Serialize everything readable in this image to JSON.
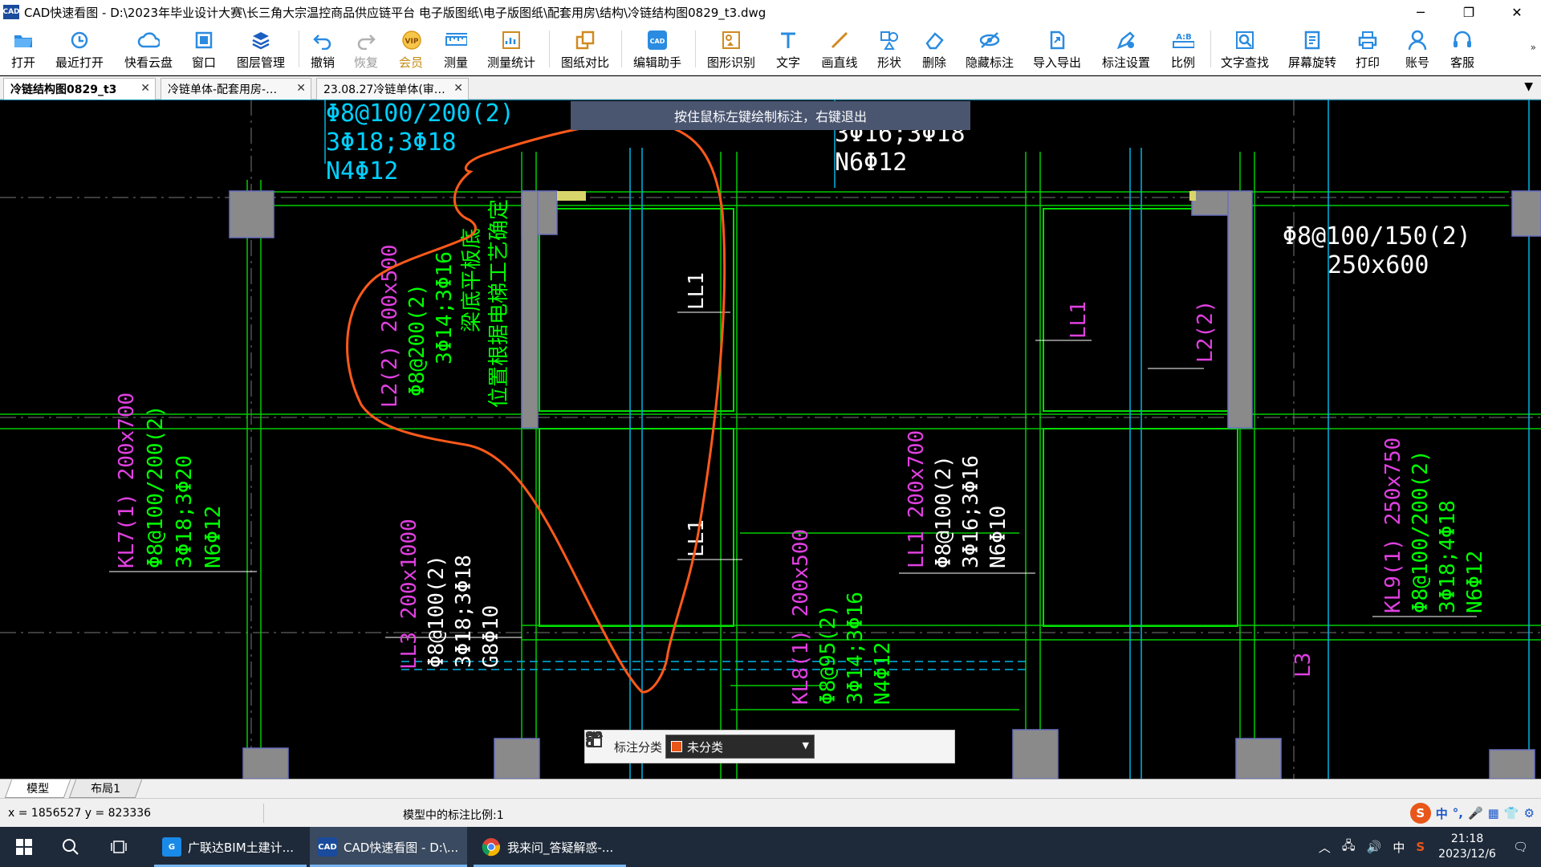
{
  "window": {
    "title": "CAD快速看图 - D:\\2023年毕业设计大赛\\长三角大宗温控商品供应链平台 电子版图纸\\电子版图纸\\配套用房\\结构\\冷链结构图0829_t3.dwg",
    "logo_text": "CAD",
    "controls": [
      "─",
      "❐",
      "✕"
    ]
  },
  "toolbar": {
    "items": [
      {
        "label": "打开",
        "icon": "folder-open-icon"
      },
      {
        "label": "最近打开",
        "icon": "history-icon"
      },
      {
        "label": "快看云盘",
        "icon": "cloud-icon"
      },
      {
        "label": "窗口",
        "icon": "window-icon"
      },
      {
        "label": "图层管理",
        "icon": "layers-icon"
      },
      {
        "label": "撤销",
        "icon": "undo-icon"
      },
      {
        "label": "恢复",
        "icon": "redo-icon"
      },
      {
        "label": "会员",
        "icon": "vip-icon"
      },
      {
        "label": "测量",
        "icon": "ruler-icon"
      },
      {
        "label": "测量统计",
        "icon": "measure-stats-icon"
      },
      {
        "label": "图纸对比",
        "icon": "compare-icon"
      },
      {
        "label": "编辑助手",
        "icon": "edit-assistant-icon"
      },
      {
        "label": "图形识别",
        "icon": "shape-recognize-icon"
      },
      {
        "label": "文字",
        "icon": "text-icon"
      },
      {
        "label": "画直线",
        "icon": "line-icon"
      },
      {
        "label": "形状",
        "icon": "shapes-icon"
      },
      {
        "label": "删除",
        "icon": "eraser-icon"
      },
      {
        "label": "隐藏标注",
        "icon": "hide-annotation-icon"
      },
      {
        "label": "导入导出",
        "icon": "import-export-icon"
      },
      {
        "label": "标注设置",
        "icon": "annotation-settings-icon"
      },
      {
        "label": "比例",
        "icon": "scale-icon"
      },
      {
        "label": "文字查找",
        "icon": "text-search-icon"
      },
      {
        "label": "屏幕旋转",
        "icon": "screen-rotate-icon"
      },
      {
        "label": "打印",
        "icon": "print-icon"
      },
      {
        "label": "账号",
        "icon": "user-icon"
      },
      {
        "label": "客服",
        "icon": "headset-icon"
      }
    ],
    "more": "»"
  },
  "tabs": [
    {
      "label": "冷链结构图0829_t3",
      "active": true
    },
    {
      "label": "冷链单体-配套用房-…",
      "active": false
    },
    {
      "label": "23.08.27冷链单体(审…",
      "active": false
    }
  ],
  "tab_dropdown": "▼",
  "canvas": {
    "hint": "按住鼠标左键绘制标注，右键退出",
    "texts": {
      "t1a": "Φ8@100/200(2)",
      "t1b": "3Φ18;3Φ18",
      "t1c": "N4Φ12",
      "t2a": "3Φ16;3Φ18",
      "t2b": "N6Φ12",
      "t3a": "Φ8@100/150(2)",
      "t3b": "250x600",
      "l2a": "L2(2) 200x500",
      "l2b": "Φ8@200(2)",
      "l2c": "3Φ14;3Φ16",
      "l2d": "梁底平板底",
      "l2e": "位置根据电梯工艺确定",
      "ll1a": "LL1",
      "ll1b": "LL1",
      "ll1c": "LL1",
      "l2r": "L2(2)",
      "kl7a": "KL7(1) 200x700",
      "kl7b": "Φ8@100/200(2)",
      "kl7c": "3Φ18;3Φ20",
      "kl7d": "N6Φ12",
      "ll3a": "LL3 200x1000",
      "ll3b": "Φ8@100(2)",
      "ll3c": "3Φ18;3Φ18",
      "ll3d": "G8Φ10",
      "kl8a": "KL8(1) 200x500",
      "kl8b": "Φ8@95(2)",
      "kl8c": "3Φ14;3Φ16",
      "kl8d": "N4Φ12",
      "ll1d": "LL1 200x700",
      "ll1e": "Φ8@100(2)",
      "ll1f": "3Φ16;3Φ16",
      "ll1g": "N6Φ10",
      "kl9a": "KL9(1) 250x750",
      "kl9b": "Φ8@100/200(2)",
      "kl9c": "3Φ18;4Φ18",
      "kl9d": "N6Φ12",
      "l3": "L3"
    },
    "colors": {
      "magenta": "#e040e0",
      "green": "#00ff00",
      "white": "#ffffff",
      "cyan": "#00d0ff",
      "line_green": "#00cc00",
      "orange": "#ff5a1a",
      "column": "#8a8a8a"
    }
  },
  "annotation_toolbar": {
    "label": "标注分类",
    "selected": "未分类",
    "swatch_color": "#e8561a"
  },
  "layout_tabs": [
    {
      "label": "模型",
      "active": true
    },
    {
      "label": "布局1",
      "active": false
    }
  ],
  "status": {
    "coords": "x = 1856527  y = 823336",
    "scale": "模型中的标注比例:1",
    "ime": [
      "S",
      "中",
      "°,",
      "🎤",
      "▦",
      "👕",
      "⚙"
    ]
  },
  "taskbar": {
    "apps": [
      {
        "label": "广联达BIM土建计...",
        "icon_text": "G",
        "active": false
      },
      {
        "label": "CAD快速看图 - D:\\...",
        "icon_text": "CAD",
        "active": true
      },
      {
        "label": "我来问_答疑解惑-...",
        "icon_text": "",
        "active": false
      }
    ],
    "time": "21:18",
    "date": "2023/12/6",
    "tray_ime": "中"
  }
}
